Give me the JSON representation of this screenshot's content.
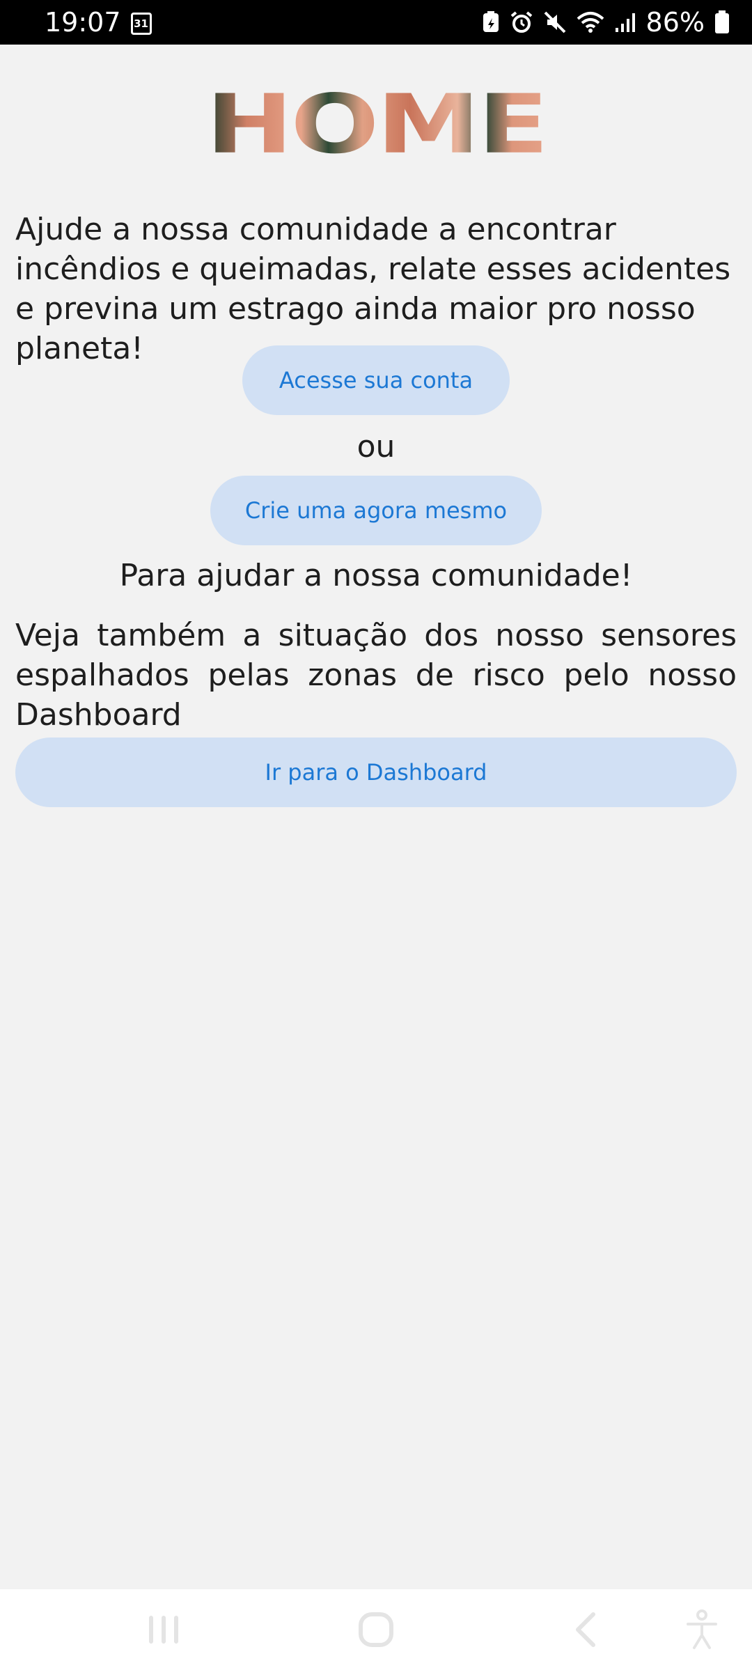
{
  "status_bar": {
    "time": "19:07",
    "calendar_day": "31",
    "battery": "86%"
  },
  "page": {
    "title": "HOME",
    "intro": "Ajude a nossa comunidade a encontrar incêndios e queimadas, relate esses acidentes e previna um estrago ainda maior pro nosso planeta!",
    "login_button": "Acesse sua conta",
    "or_text": "ou",
    "create_button": "Crie uma agora mesmo",
    "help_text": "Para ajudar a nossa comunidade!",
    "sensor_text": "Veja também a situação dos nosso sensores espalhados pelas zonas de risco pelo nosso Dashboard",
    "dashboard_button": "Ir para o Dashboard"
  },
  "nav": {
    "icons": [
      "recent-apps-icon",
      "home-icon",
      "back-icon",
      "accessibility-icon"
    ]
  },
  "colors": {
    "background": "#f2f2f2",
    "button_bg": "#d1e0f4",
    "button_text": "#1c78d4"
  }
}
